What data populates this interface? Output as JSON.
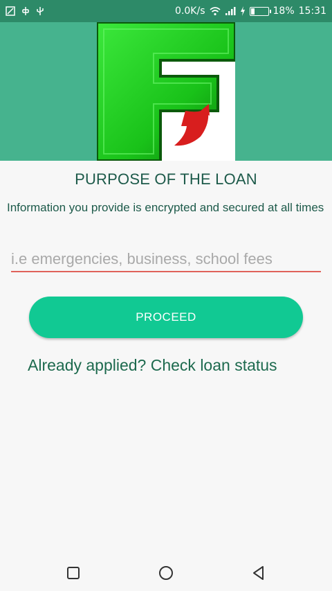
{
  "status_bar": {
    "speed": "0.0K/s",
    "battery": "18%",
    "time": "15:31",
    "icons": [
      "screenshot-icon",
      "usb-debug-icon",
      "usb-icon",
      "wifi-icon",
      "signal-icon",
      "charging-icon",
      "battery-icon"
    ]
  },
  "banner": {
    "logo_icon": "f-logo-icon",
    "background_color": "#46b38e"
  },
  "main": {
    "title": "PURPOSE OF THE LOAN",
    "info": "Information you provide is encrypted and secured at all times",
    "purpose_input": {
      "value": "",
      "placeholder": "i.e emergencies, business, school fees"
    },
    "proceed_label": "PROCEED",
    "check_status_link": "Already applied? Check loan status"
  },
  "colors": {
    "accent": "#11c993",
    "text_dark_green": "#1d5a4a",
    "input_underline": "#e0625b"
  },
  "nav_bar": {
    "icons": [
      "recents-icon",
      "home-icon",
      "back-icon"
    ]
  }
}
